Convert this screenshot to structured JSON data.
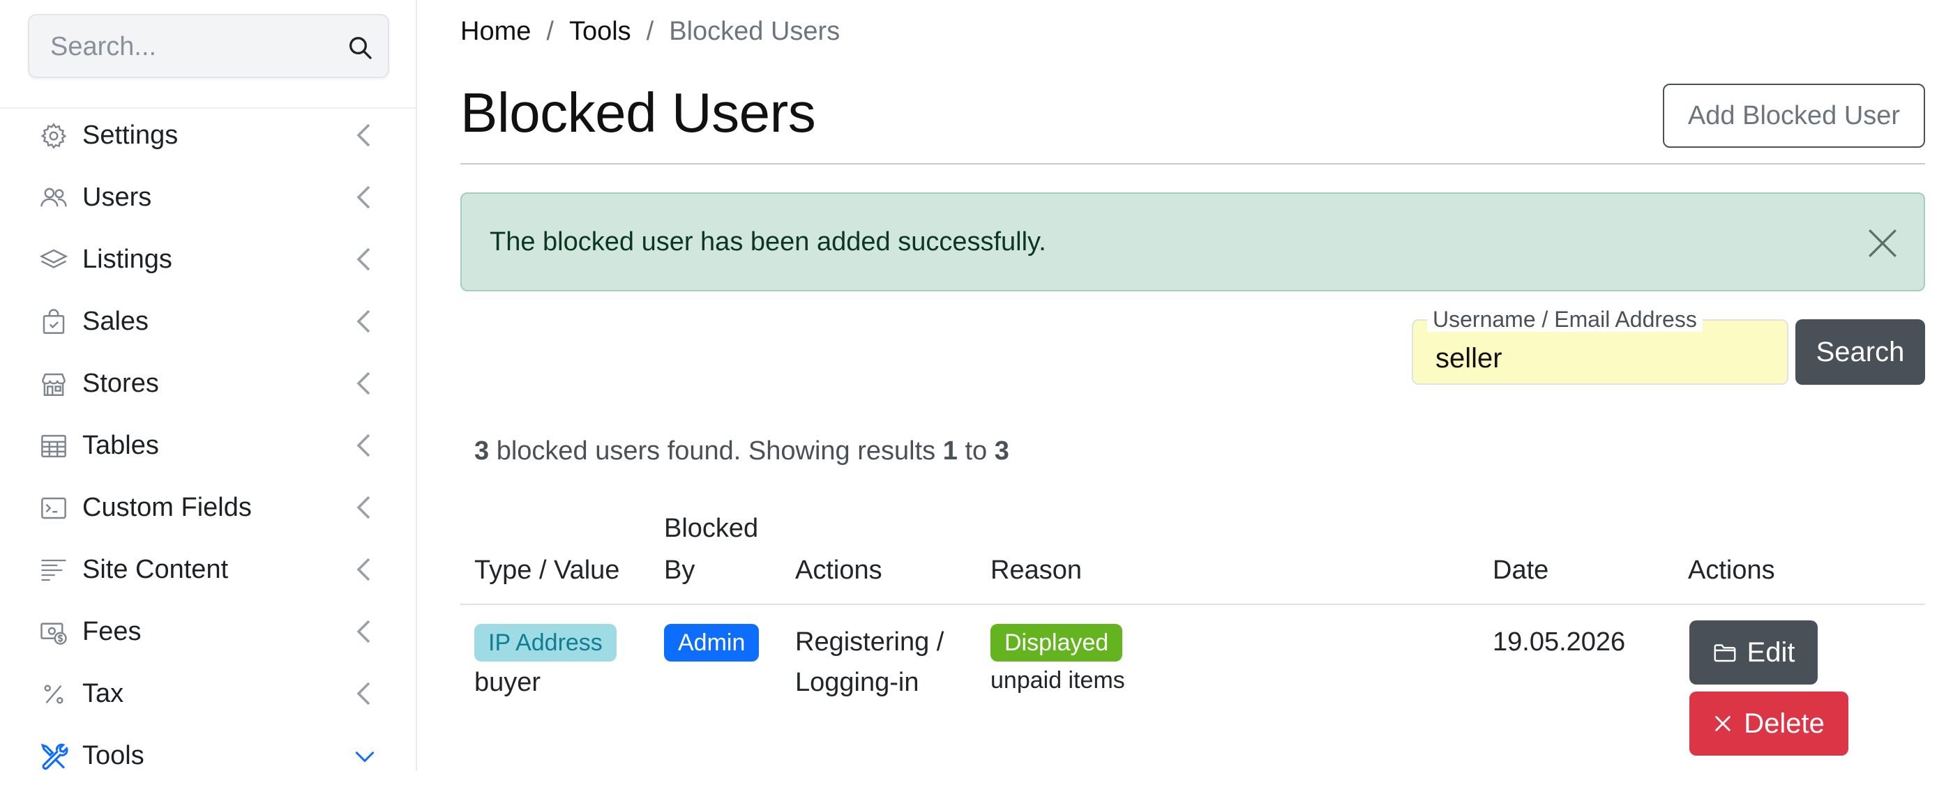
{
  "sidebar": {
    "search": {
      "placeholder": "Search..."
    },
    "items": [
      {
        "label": "Settings",
        "icon": "gear-icon"
      },
      {
        "label": "Users",
        "icon": "users-icon"
      },
      {
        "label": "Listings",
        "icon": "layers-icon"
      },
      {
        "label": "Sales",
        "icon": "shopping-bag-icon"
      },
      {
        "label": "Stores",
        "icon": "store-icon"
      },
      {
        "label": "Tables",
        "icon": "table-icon"
      },
      {
        "label": "Custom Fields",
        "icon": "terminal-icon"
      },
      {
        "label": "Site Content",
        "icon": "text-lines-icon"
      },
      {
        "label": "Fees",
        "icon": "cash-icon"
      },
      {
        "label": "Tax",
        "icon": "percent-icon"
      },
      {
        "label": "Tools",
        "icon": "tools-icon",
        "expanded": true
      }
    ]
  },
  "breadcrumb": {
    "home": "Home",
    "tools": "Tools",
    "current": "Blocked Users",
    "separator": "/"
  },
  "page": {
    "title": "Blocked Users",
    "add_button": "Add Blocked User"
  },
  "alert": {
    "message": "The blocked user has been added successfully."
  },
  "filter": {
    "label": "Username / Email Address",
    "value": "seller",
    "button": "Search"
  },
  "results": {
    "count": "3",
    "text_mid": "blocked users found. Showing results",
    "from": "1",
    "to_word": "to",
    "to": "3"
  },
  "table": {
    "headers": {
      "type_value": "Type / Value",
      "blocked_by_1": "Blocked",
      "blocked_by_2": "By",
      "actions": "Actions",
      "reason": "Reason",
      "date": "Date",
      "actions2": "Actions"
    },
    "rows": [
      {
        "type": "IP Address",
        "value": "buyer",
        "blocked_by": "Admin",
        "actions_line1": "Registering /",
        "actions_line2": "Logging-in",
        "reason_badge": "Displayed",
        "reason_text": "unpaid items",
        "date": "19.05.2026",
        "edit": "Edit",
        "delete": "Delete"
      }
    ]
  },
  "colors": {
    "accent": "#0d6efd",
    "success_bg": "#d1e7dd",
    "danger": "#dc3545",
    "secondary": "#495057",
    "tools_icon": "#0d6efd"
  }
}
